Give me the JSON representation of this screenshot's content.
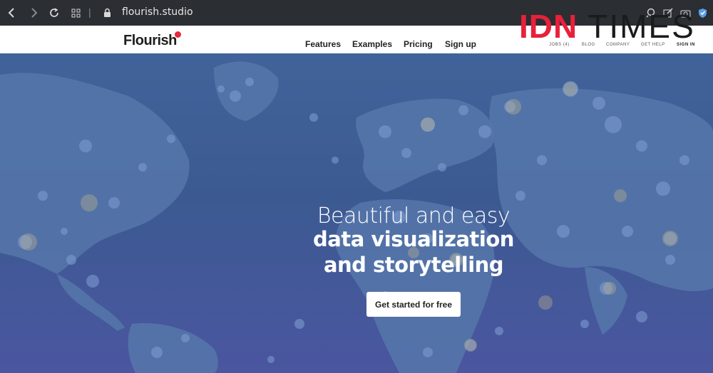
{
  "browser": {
    "url": "flourish.studio",
    "back_icon": "chevron-left-icon",
    "forward_icon": "chevron-right-icon",
    "reload_icon": "reload-icon",
    "tabs_icon": "grid-icon",
    "separator": "|",
    "lock_icon": "lock-icon"
  },
  "header": {
    "logo": "Flourish",
    "nav": [
      "Features",
      "Examples",
      "Pricing",
      "Sign up"
    ],
    "mini_nav": [
      "JOBS (4)",
      "BLOG",
      "COMPANY",
      "GET HELP",
      "SIGN IN"
    ]
  },
  "watermark": {
    "part1": "IDN",
    "part2": "TIMES"
  },
  "hero": {
    "line1": "Beautiful and easy",
    "line2": "data visualization",
    "line3": "and storytelling",
    "cta": "Get started for free"
  },
  "colors": {
    "accent": "#e8283c",
    "hero_bg": "#3f5f98",
    "land": "#5b7aae"
  }
}
